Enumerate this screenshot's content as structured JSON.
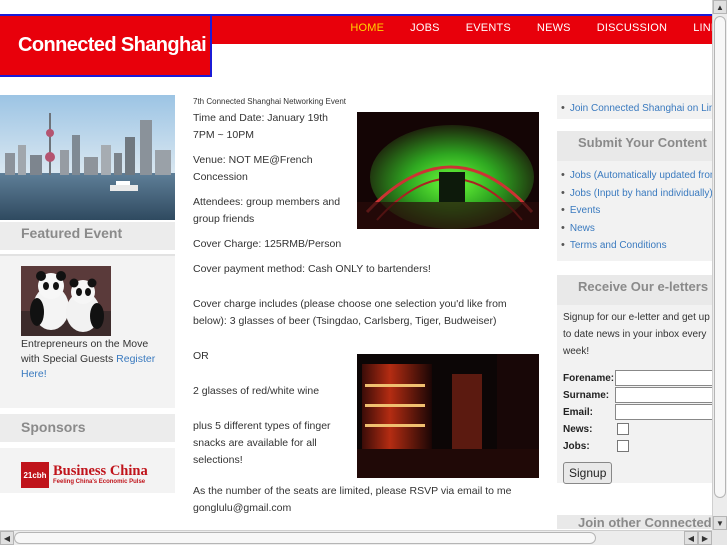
{
  "site": {
    "title": "Connected Shanghai"
  },
  "nav": {
    "items": [
      "HOME",
      "JOBS",
      "EVENTS",
      "NEWS",
      "DISCUSSION",
      "LINKS"
    ]
  },
  "left": {
    "featured_title": "Featured Event",
    "featured_text": "Entrepreneurs on the Move with Special Guests ",
    "featured_link": "Register Here!",
    "sponsors_title": "Sponsors",
    "sponsor_mark": "21cbh",
    "sponsor_name": "Business China",
    "sponsor_tagline": "Feeling China's Economic Pulse"
  },
  "main": {
    "event_title": "7th Connected Shanghai Networking Event",
    "time": "Time and Date: January 19th 7PM ~ 10PM",
    "venue": "Venue: NOT ME@French Concession",
    "attendees": "Attendees: group members and group friends",
    "cover_charge": "Cover Charge: 125RMB/Person",
    "payment": "Cover payment method: Cash ONLY to bartenders!",
    "includes": "Cover charge includes (please choose one selection you'd like from below): 3 glasses of beer (Tsingdao, Carlsberg, Tiger, Budweiser)",
    "or": "OR",
    "wine": "2 glasses of red/white wine",
    "snacks": "plus 5 different types of finger snacks are available for all selections!",
    "rsvp": "As the number of the seats are limited, please RSVP via email to me gonglulu@gmail.com"
  },
  "right": {
    "join_link": "Join Connected Shanghai on LinkedIn",
    "submit_title": "Submit Your Content",
    "submit_links": [
      "Jobs (Automatically updated from",
      "Jobs (Input by hand individually)",
      "Events",
      "News",
      "Terms and Conditions"
    ],
    "receive_title": "Receive Our e-letters",
    "receive_text": "Signup for our e-letter and get up to date news in your inbox every week!",
    "form": {
      "forename": "Forename:",
      "surname": "Surname:",
      "email": "Email:",
      "news": "News:",
      "jobs": "Jobs:",
      "signup": "Signup"
    },
    "join_other_title": "Join other Connected"
  },
  "colors": {
    "brand_red": "#e8000b",
    "border_blue": "#1b1bd6",
    "nav_active": "#ffd400",
    "link": "#3a7abf"
  }
}
